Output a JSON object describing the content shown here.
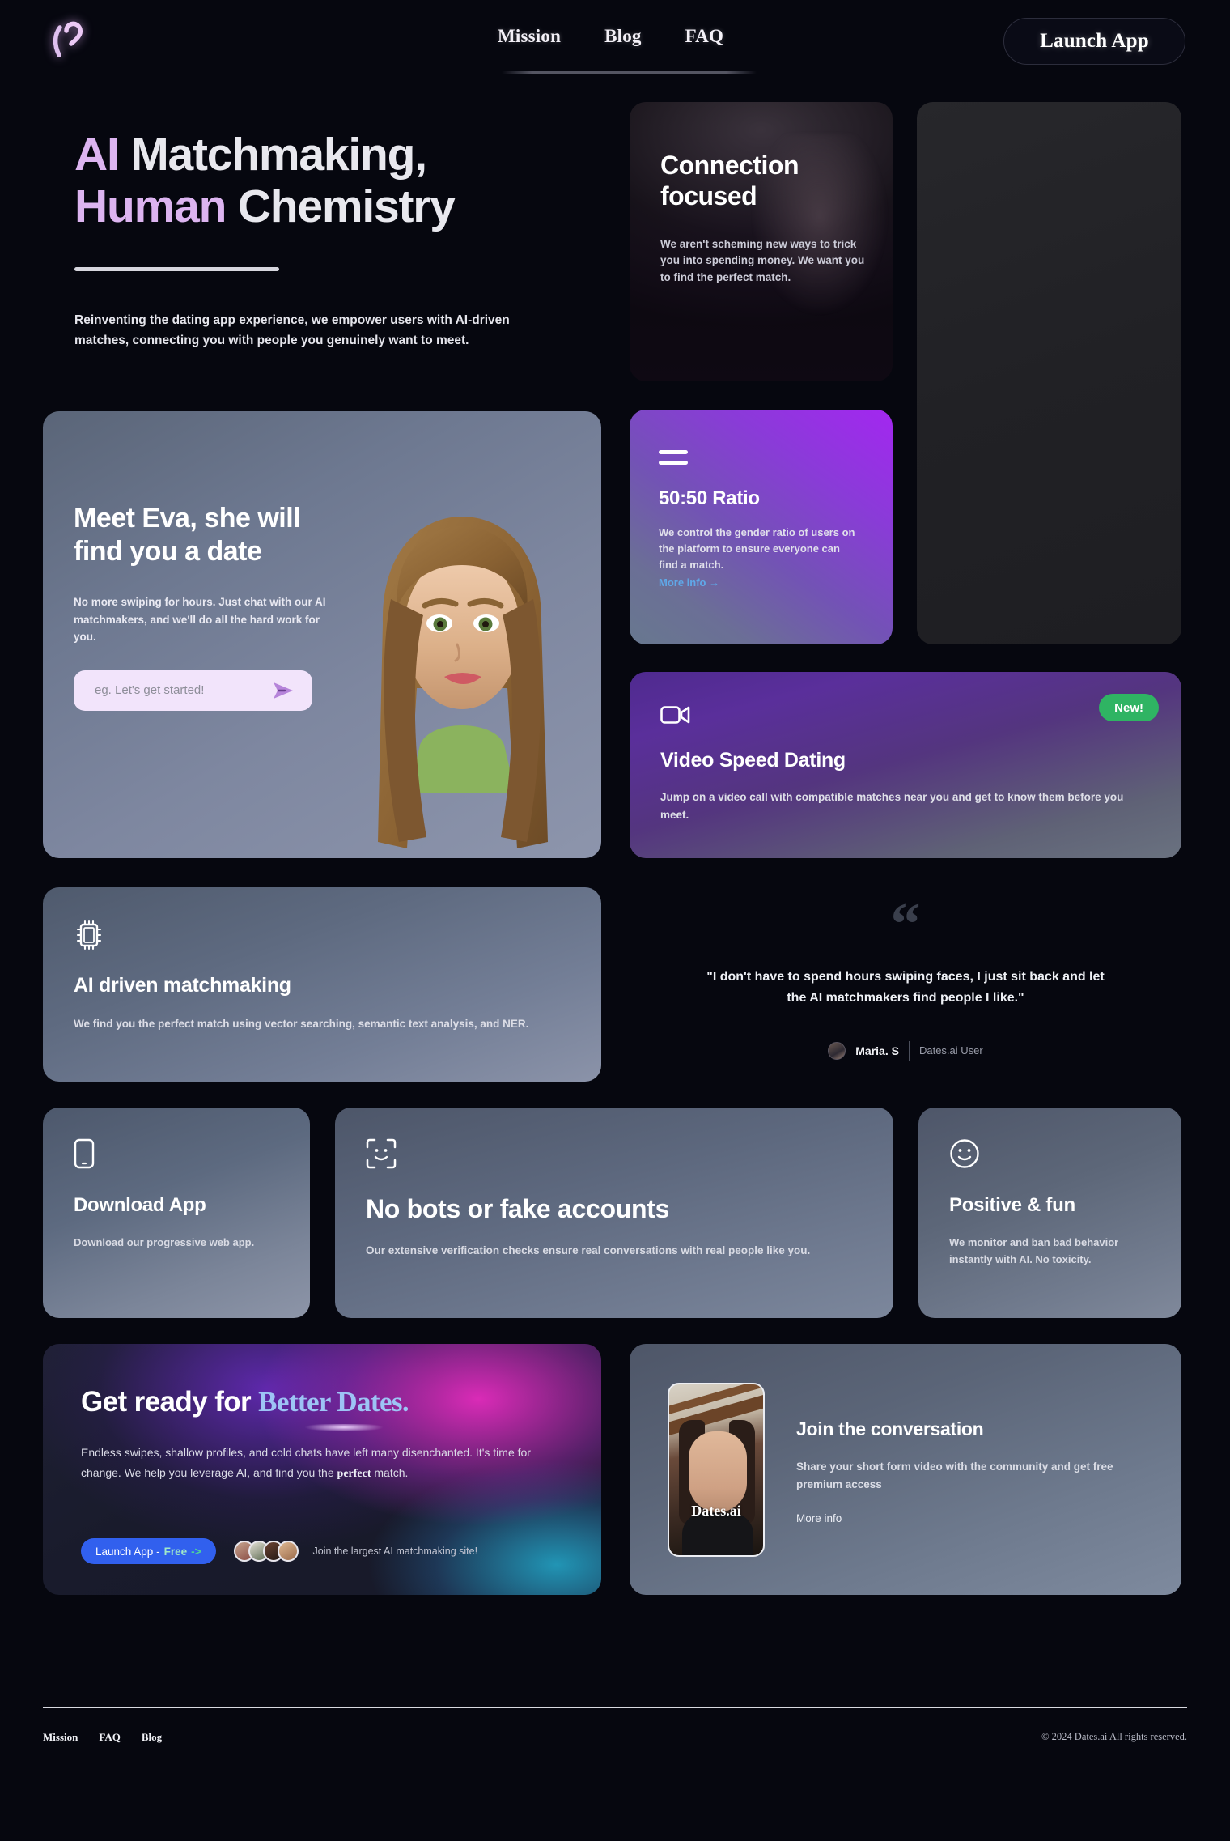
{
  "header": {
    "logo_icon": "heart-logo-icon",
    "nav": [
      {
        "label": "Mission"
      },
      {
        "label": "Blog"
      },
      {
        "label": "FAQ"
      }
    ],
    "launch_app_label": "Launch App"
  },
  "hero": {
    "title_line1_accent": "AI",
    "title_line1_rest": " Matchmaking,",
    "title_line2_accent": "Human",
    "title_line2_rest": " Chemistry",
    "subtitle": "Reinventing the dating app experience, we empower users with AI-driven matches, connecting you with people you genuinely want to meet."
  },
  "connection_card": {
    "title": "Connection focused",
    "body": "We aren't scheming new ways to trick you into spending money. We want you to find the perfect match."
  },
  "eva_card": {
    "title": "Meet Eva, she will find you a date",
    "body": "No more swiping for hours. Just chat with our AI matchmakers, and we'll do all the hard work for you.",
    "input_placeholder": "eg. Let's get started!",
    "input_value": "",
    "send_icon": "send-arrow-icon",
    "avatar_alt": "eva-avatar"
  },
  "ratio_card": {
    "icon": "equals-icon",
    "title": "50:50 Ratio",
    "body": "We control the gender ratio of users on the platform to ensure everyone can find a match.",
    "link_label": "More info →"
  },
  "video_card": {
    "icon": "video-camera-icon",
    "badge": "New!",
    "badge_color": "#2fb463",
    "title": "Video Speed Dating",
    "body": "Jump on a video call with compatible matches near you and get to know them before you meet."
  },
  "ai_card": {
    "icon": "cpu-chip-icon",
    "title": "AI driven matchmaking",
    "body": "We find you the perfect match using vector searching, semantic text analysis, and NER."
  },
  "testimonial": {
    "quote_mark": "“",
    "quote": "\"I don't have to spend hours swiping faces, I just sit back and let the AI matchmakers find people I like.\"",
    "author": "Maria. S",
    "role": "Dates.ai User"
  },
  "features": [
    {
      "icon": "mobile-phone-icon",
      "title": "Download App",
      "body": "Download our progressive web app."
    },
    {
      "icon": "face-scan-icon",
      "title": "No bots or fake accounts",
      "body": "Our extensive verification checks ensure real conversations with real people like you."
    },
    {
      "icon": "smiley-face-icon",
      "title": "Positive & fun",
      "body": "We monitor and ban bad behavior instantly with AI. No toxicity."
    }
  ],
  "cta_card": {
    "title_plain": "Get ready for ",
    "title_serif": "Better Dates.",
    "body_part1": "Endless swipes, shallow profiles, and cold chats have left many disenchanted. It's time for change. We help you leverage AI, and find you the ",
    "body_serif": "perfect",
    "body_part2": " match.",
    "button_label": "Launch App - ",
    "button_free": "Free",
    "button_arrow": "->",
    "button_color": "#3160ee",
    "avatars_caption": "Join the largest AI matchmaking site!"
  },
  "join_card": {
    "video_watermark": "Dates.ai",
    "title": "Join the conversation",
    "body": "Share your short form video with the community and get free premium access",
    "link_label": "More info"
  },
  "footer": {
    "links": [
      {
        "label": "Mission"
      },
      {
        "label": "FAQ"
      },
      {
        "label": "Blog"
      }
    ],
    "copyright": "© 2024 Dates.ai All rights reserved."
  }
}
